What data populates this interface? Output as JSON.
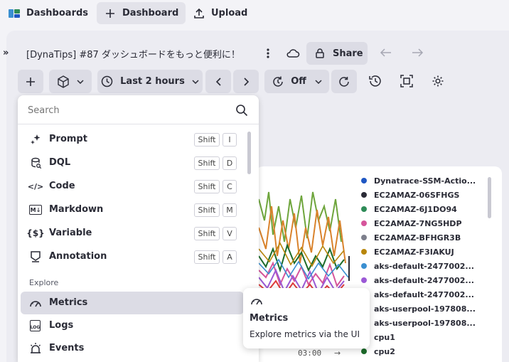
{
  "topbar": {
    "dashboards_label": "Dashboards",
    "new_dashboard_label": "Dashboard",
    "upload_label": "Upload"
  },
  "dashboard": {
    "expand_label": "»",
    "title": "[DynaTips] #87 ダッシュボードをもっと便利に！",
    "share_label": "Share"
  },
  "toolbar": {
    "timeframe_label": "Last 2 hours",
    "refresh_label": "Off"
  },
  "menu": {
    "search_placeholder": "Search",
    "items": [
      {
        "label": "Prompt",
        "icon": "sparkle-icon",
        "keys": [
          "Shift",
          "I"
        ]
      },
      {
        "label": "DQL",
        "icon": "dql-icon",
        "keys": [
          "Shift",
          "D"
        ]
      },
      {
        "label": "Code",
        "icon": "code-icon",
        "keys": [
          "Shift",
          "C"
        ]
      },
      {
        "label": "Markdown",
        "icon": "markdown-icon",
        "keys": [
          "Shift",
          "M"
        ]
      },
      {
        "label": "Variable",
        "icon": "variable-icon",
        "keys": [
          "Shift",
          "V"
        ]
      },
      {
        "label": "Annotation",
        "icon": "annotation-icon",
        "keys": [
          "Shift",
          "A"
        ]
      }
    ],
    "section_explore": "Explore",
    "explore_items": [
      {
        "label": "Metrics",
        "icon": "gauge-icon",
        "selected": true
      },
      {
        "label": "Logs",
        "icon": "log-icon"
      },
      {
        "label": "Events",
        "icon": "siren-icon"
      }
    ],
    "icon_glyphs": {
      "markdown": "M↓",
      "variable": "{$}",
      "code": "</>",
      "log": "LOG"
    }
  },
  "tooltip": {
    "title": "Metrics",
    "description": "Explore metrics via the UI"
  },
  "chart": {
    "time_label": "03:00",
    "arrow": "→",
    "legend": [
      {
        "label": "Dynatrace-SSM-Actio...",
        "color": "#1f57c3"
      },
      {
        "label": "EC2AMAZ-06SFHGS",
        "color": "#2a2b36"
      },
      {
        "label": "EC2AMAZ-6J1DO94",
        "color": "#2e8b57"
      },
      {
        "label": "EC2AMAZ-7NG5HDP",
        "color": "#d6559b"
      },
      {
        "label": "EC2AMAZ-BFHGR3B",
        "color": "#7d7f8c"
      },
      {
        "label": "EC2AMAZ-F3IAKUJ",
        "color": "#b8860b"
      },
      {
        "label": "aks-default-2477002...",
        "color": "#3a8fd1"
      },
      {
        "label": "aks-default-2477002...",
        "color": "#9b59d6"
      },
      {
        "label": "aks-default-2477002...",
        "color": "#e0507a"
      },
      {
        "label": "aks-userpool-197808...",
        "color": "#1e3f99"
      },
      {
        "label": "aks-userpool-197808...",
        "color": "#2a2b36"
      },
      {
        "label": "cpu1",
        "color": "#2a2b36"
      },
      {
        "label": "cpu2",
        "color": "#1c6b2a"
      }
    ]
  }
}
